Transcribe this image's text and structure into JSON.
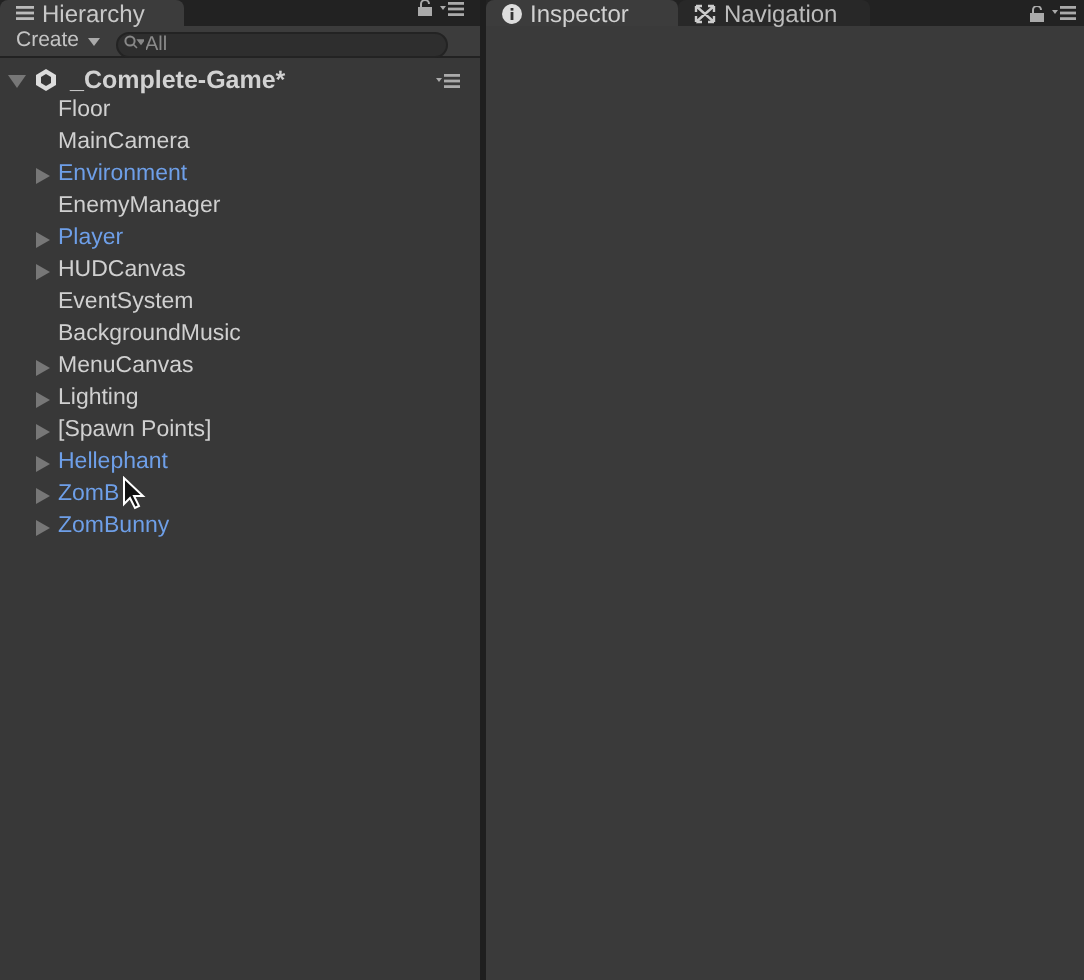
{
  "hierarchy": {
    "tab": {
      "label": "Hierarchy",
      "selected": true
    },
    "create_button": "Create",
    "search": {
      "placeholder": "All"
    },
    "scene": {
      "name": "_Complete-Game*",
      "expanded": true
    },
    "items": [
      {
        "name": "Floor",
        "prefab": false,
        "has_children": false
      },
      {
        "name": "MainCamera",
        "prefab": false,
        "has_children": false
      },
      {
        "name": "Environment",
        "prefab": true,
        "has_children": true
      },
      {
        "name": "EnemyManager",
        "prefab": false,
        "has_children": false
      },
      {
        "name": "Player",
        "prefab": true,
        "has_children": true
      },
      {
        "name": "HUDCanvas",
        "prefab": false,
        "has_children": true
      },
      {
        "name": "EventSystem",
        "prefab": false,
        "has_children": false
      },
      {
        "name": "BackgroundMusic",
        "prefab": false,
        "has_children": false
      },
      {
        "name": "MenuCanvas",
        "prefab": false,
        "has_children": true
      },
      {
        "name": "Lighting",
        "prefab": false,
        "has_children": true
      },
      {
        "name": "[Spawn Points]",
        "prefab": false,
        "has_children": true
      },
      {
        "name": "Hellephant",
        "prefab": true,
        "has_children": true
      },
      {
        "name": "ZomB",
        "prefab": true,
        "has_children": true
      },
      {
        "name": "ZomBunny",
        "prefab": true,
        "has_children": true
      }
    ]
  },
  "tabs": [
    {
      "label": "Inspector",
      "selected": true
    },
    {
      "label": "Navigation",
      "selected": false
    }
  ]
}
